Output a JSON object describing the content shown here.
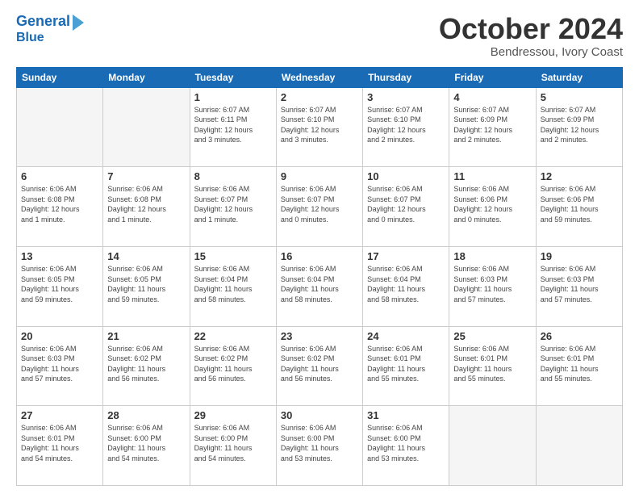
{
  "header": {
    "logo_line1": "General",
    "logo_line2": "Blue",
    "month": "October 2024",
    "location": "Bendressou, Ivory Coast"
  },
  "weekdays": [
    "Sunday",
    "Monday",
    "Tuesday",
    "Wednesday",
    "Thursday",
    "Friday",
    "Saturday"
  ],
  "weeks": [
    [
      {
        "day": "",
        "info": ""
      },
      {
        "day": "",
        "info": ""
      },
      {
        "day": "1",
        "info": "Sunrise: 6:07 AM\nSunset: 6:11 PM\nDaylight: 12 hours\nand 3 minutes."
      },
      {
        "day": "2",
        "info": "Sunrise: 6:07 AM\nSunset: 6:10 PM\nDaylight: 12 hours\nand 3 minutes."
      },
      {
        "day": "3",
        "info": "Sunrise: 6:07 AM\nSunset: 6:10 PM\nDaylight: 12 hours\nand 2 minutes."
      },
      {
        "day": "4",
        "info": "Sunrise: 6:07 AM\nSunset: 6:09 PM\nDaylight: 12 hours\nand 2 minutes."
      },
      {
        "day": "5",
        "info": "Sunrise: 6:07 AM\nSunset: 6:09 PM\nDaylight: 12 hours\nand 2 minutes."
      }
    ],
    [
      {
        "day": "6",
        "info": "Sunrise: 6:06 AM\nSunset: 6:08 PM\nDaylight: 12 hours\nand 1 minute."
      },
      {
        "day": "7",
        "info": "Sunrise: 6:06 AM\nSunset: 6:08 PM\nDaylight: 12 hours\nand 1 minute."
      },
      {
        "day": "8",
        "info": "Sunrise: 6:06 AM\nSunset: 6:07 PM\nDaylight: 12 hours\nand 1 minute."
      },
      {
        "day": "9",
        "info": "Sunrise: 6:06 AM\nSunset: 6:07 PM\nDaylight: 12 hours\nand 0 minutes."
      },
      {
        "day": "10",
        "info": "Sunrise: 6:06 AM\nSunset: 6:07 PM\nDaylight: 12 hours\nand 0 minutes."
      },
      {
        "day": "11",
        "info": "Sunrise: 6:06 AM\nSunset: 6:06 PM\nDaylight: 12 hours\nand 0 minutes."
      },
      {
        "day": "12",
        "info": "Sunrise: 6:06 AM\nSunset: 6:06 PM\nDaylight: 11 hours\nand 59 minutes."
      }
    ],
    [
      {
        "day": "13",
        "info": "Sunrise: 6:06 AM\nSunset: 6:05 PM\nDaylight: 11 hours\nand 59 minutes."
      },
      {
        "day": "14",
        "info": "Sunrise: 6:06 AM\nSunset: 6:05 PM\nDaylight: 11 hours\nand 59 minutes."
      },
      {
        "day": "15",
        "info": "Sunrise: 6:06 AM\nSunset: 6:04 PM\nDaylight: 11 hours\nand 58 minutes."
      },
      {
        "day": "16",
        "info": "Sunrise: 6:06 AM\nSunset: 6:04 PM\nDaylight: 11 hours\nand 58 minutes."
      },
      {
        "day": "17",
        "info": "Sunrise: 6:06 AM\nSunset: 6:04 PM\nDaylight: 11 hours\nand 58 minutes."
      },
      {
        "day": "18",
        "info": "Sunrise: 6:06 AM\nSunset: 6:03 PM\nDaylight: 11 hours\nand 57 minutes."
      },
      {
        "day": "19",
        "info": "Sunrise: 6:06 AM\nSunset: 6:03 PM\nDaylight: 11 hours\nand 57 minutes."
      }
    ],
    [
      {
        "day": "20",
        "info": "Sunrise: 6:06 AM\nSunset: 6:03 PM\nDaylight: 11 hours\nand 57 minutes."
      },
      {
        "day": "21",
        "info": "Sunrise: 6:06 AM\nSunset: 6:02 PM\nDaylight: 11 hours\nand 56 minutes."
      },
      {
        "day": "22",
        "info": "Sunrise: 6:06 AM\nSunset: 6:02 PM\nDaylight: 11 hours\nand 56 minutes."
      },
      {
        "day": "23",
        "info": "Sunrise: 6:06 AM\nSunset: 6:02 PM\nDaylight: 11 hours\nand 56 minutes."
      },
      {
        "day": "24",
        "info": "Sunrise: 6:06 AM\nSunset: 6:01 PM\nDaylight: 11 hours\nand 55 minutes."
      },
      {
        "day": "25",
        "info": "Sunrise: 6:06 AM\nSunset: 6:01 PM\nDaylight: 11 hours\nand 55 minutes."
      },
      {
        "day": "26",
        "info": "Sunrise: 6:06 AM\nSunset: 6:01 PM\nDaylight: 11 hours\nand 55 minutes."
      }
    ],
    [
      {
        "day": "27",
        "info": "Sunrise: 6:06 AM\nSunset: 6:01 PM\nDaylight: 11 hours\nand 54 minutes."
      },
      {
        "day": "28",
        "info": "Sunrise: 6:06 AM\nSunset: 6:00 PM\nDaylight: 11 hours\nand 54 minutes."
      },
      {
        "day": "29",
        "info": "Sunrise: 6:06 AM\nSunset: 6:00 PM\nDaylight: 11 hours\nand 54 minutes."
      },
      {
        "day": "30",
        "info": "Sunrise: 6:06 AM\nSunset: 6:00 PM\nDaylight: 11 hours\nand 53 minutes."
      },
      {
        "day": "31",
        "info": "Sunrise: 6:06 AM\nSunset: 6:00 PM\nDaylight: 11 hours\nand 53 minutes."
      },
      {
        "day": "",
        "info": ""
      },
      {
        "day": "",
        "info": ""
      }
    ]
  ]
}
